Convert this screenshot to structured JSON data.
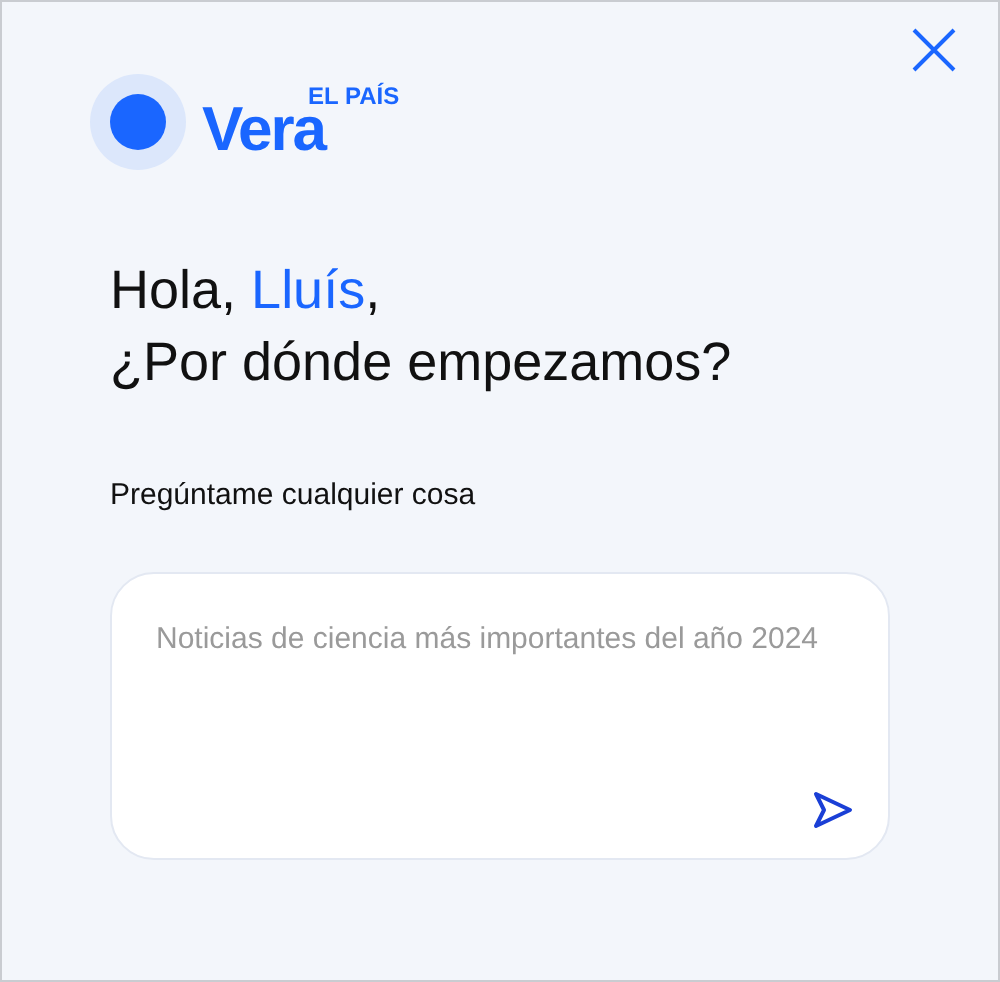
{
  "brand": {
    "name": "Vera",
    "publisher": "EL PAÍS"
  },
  "greeting": {
    "before": "Hola, ",
    "name": "Lluís",
    "after": ",",
    "question": "¿Por dónde empezamos?"
  },
  "prompt": {
    "label": "Pregúntame cualquier cosa",
    "placeholder": "Noticias de ciencia más importantes del año 2024"
  }
}
